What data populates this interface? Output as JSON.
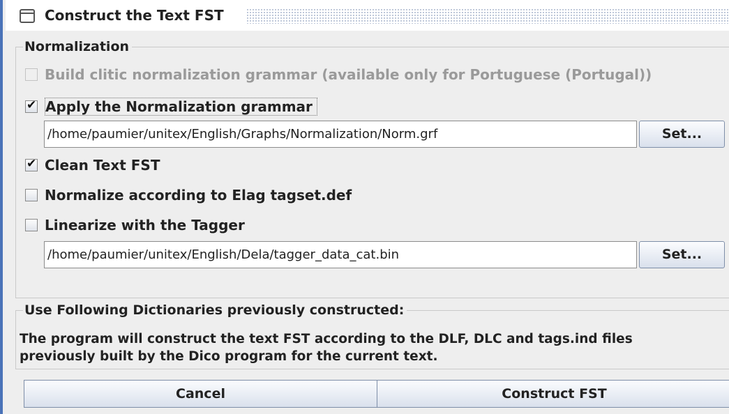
{
  "window": {
    "title": "Construct the Text FST"
  },
  "normalization": {
    "legend": "Normalization",
    "clitic": {
      "label": "Build clitic normalization grammar (available only for Portuguese (Portugal))",
      "checked": false,
      "enabled": false
    },
    "apply_norm": {
      "label": "Apply the Normalization grammar",
      "checked": true
    },
    "norm_path": {
      "value": "/home/paumier/unitex/English/Graphs/Normalization/Norm.grf"
    },
    "norm_set_label": "Set...",
    "clean_fst": {
      "label": "Clean Text FST",
      "checked": true
    },
    "elag": {
      "label": "Normalize according to Elag tagset.def",
      "checked": false
    },
    "tagger": {
      "label": "Linearize with the Tagger",
      "checked": false
    },
    "tagger_path": {
      "value": "/home/paumier/unitex/English/Dela/tagger_data_cat.bin"
    },
    "tagger_set_label": "Set..."
  },
  "dictionaries": {
    "legend": "Use Following Dictionaries previously constructed:",
    "line1": "The program will construct the text FST according to the DLF, DLC and tags.ind files",
    "line2": "previously built by the Dico program for the current text."
  },
  "footer": {
    "cancel_label": "Cancel",
    "construct_label": "Construct FST"
  },
  "colors": {
    "window_border": "#4a73b8",
    "background": "#eeeeee",
    "button_border": "#7e8ea8"
  }
}
